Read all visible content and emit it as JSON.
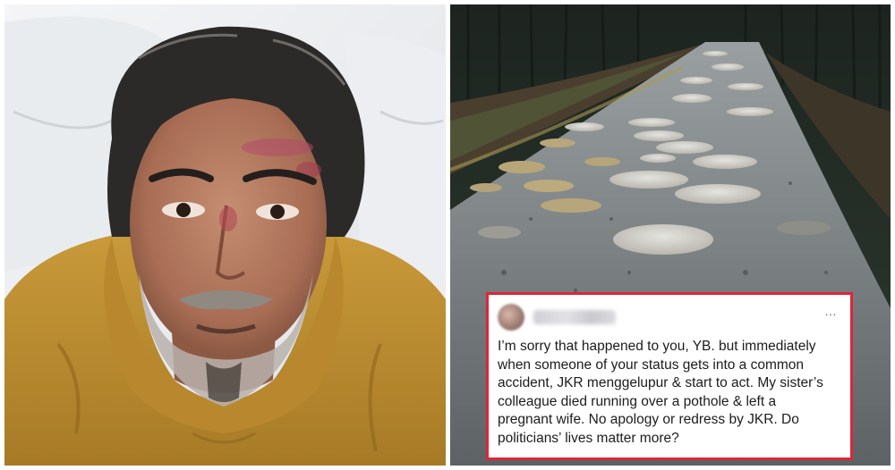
{
  "left_photo": {
    "subject": "man-in-mustard-hoodie-with-facial-bruises"
  },
  "right_photo": {
    "subject": "potholed-road-through-forest"
  },
  "tweet": {
    "handle": "",
    "more_icon": "…",
    "text": "I’m sorry that happened to you, YB. but immediately\nwhen someone of your status gets into a common\naccident, JKR menggelupur & start to act. My sister’s\ncolleague died running over a pothole & left a\npregnant wife. No apology or redress by JKR. Do\npoliticians’ lives matter more?",
    "border_color": "#e0243a"
  }
}
